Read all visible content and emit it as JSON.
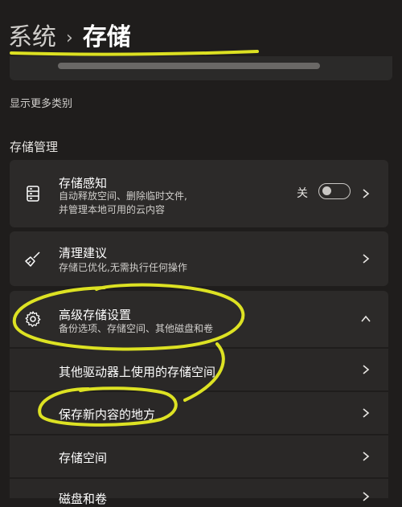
{
  "breadcrumb": {
    "parent": "系统",
    "separator": "›",
    "current": "存储"
  },
  "show_more": "显示更多类别",
  "section_title": "存储管理",
  "storage_sense": {
    "title": "存储感知",
    "desc_line1": "自动释放空间、删除临时文件,",
    "desc_line2": "并管理本地可用的云内容",
    "toggle_label": "关",
    "toggle_on": false
  },
  "cleanup": {
    "title": "清理建议",
    "desc": "存储已优化,无需执行任何操作"
  },
  "advanced": {
    "title": "高级存储设置",
    "desc": "备份选项、存储空间、其他磁盘和卷",
    "expanded": true
  },
  "sub_items": [
    {
      "label": "其他驱动器上使用的存储空间"
    },
    {
      "label": "保存新内容的地方"
    },
    {
      "label": "存储空间"
    },
    {
      "label": "磁盘和卷"
    }
  ],
  "colors": {
    "background": "#1f1d1c",
    "card": "#2c2a29",
    "highlighter": "#e7ec23"
  }
}
